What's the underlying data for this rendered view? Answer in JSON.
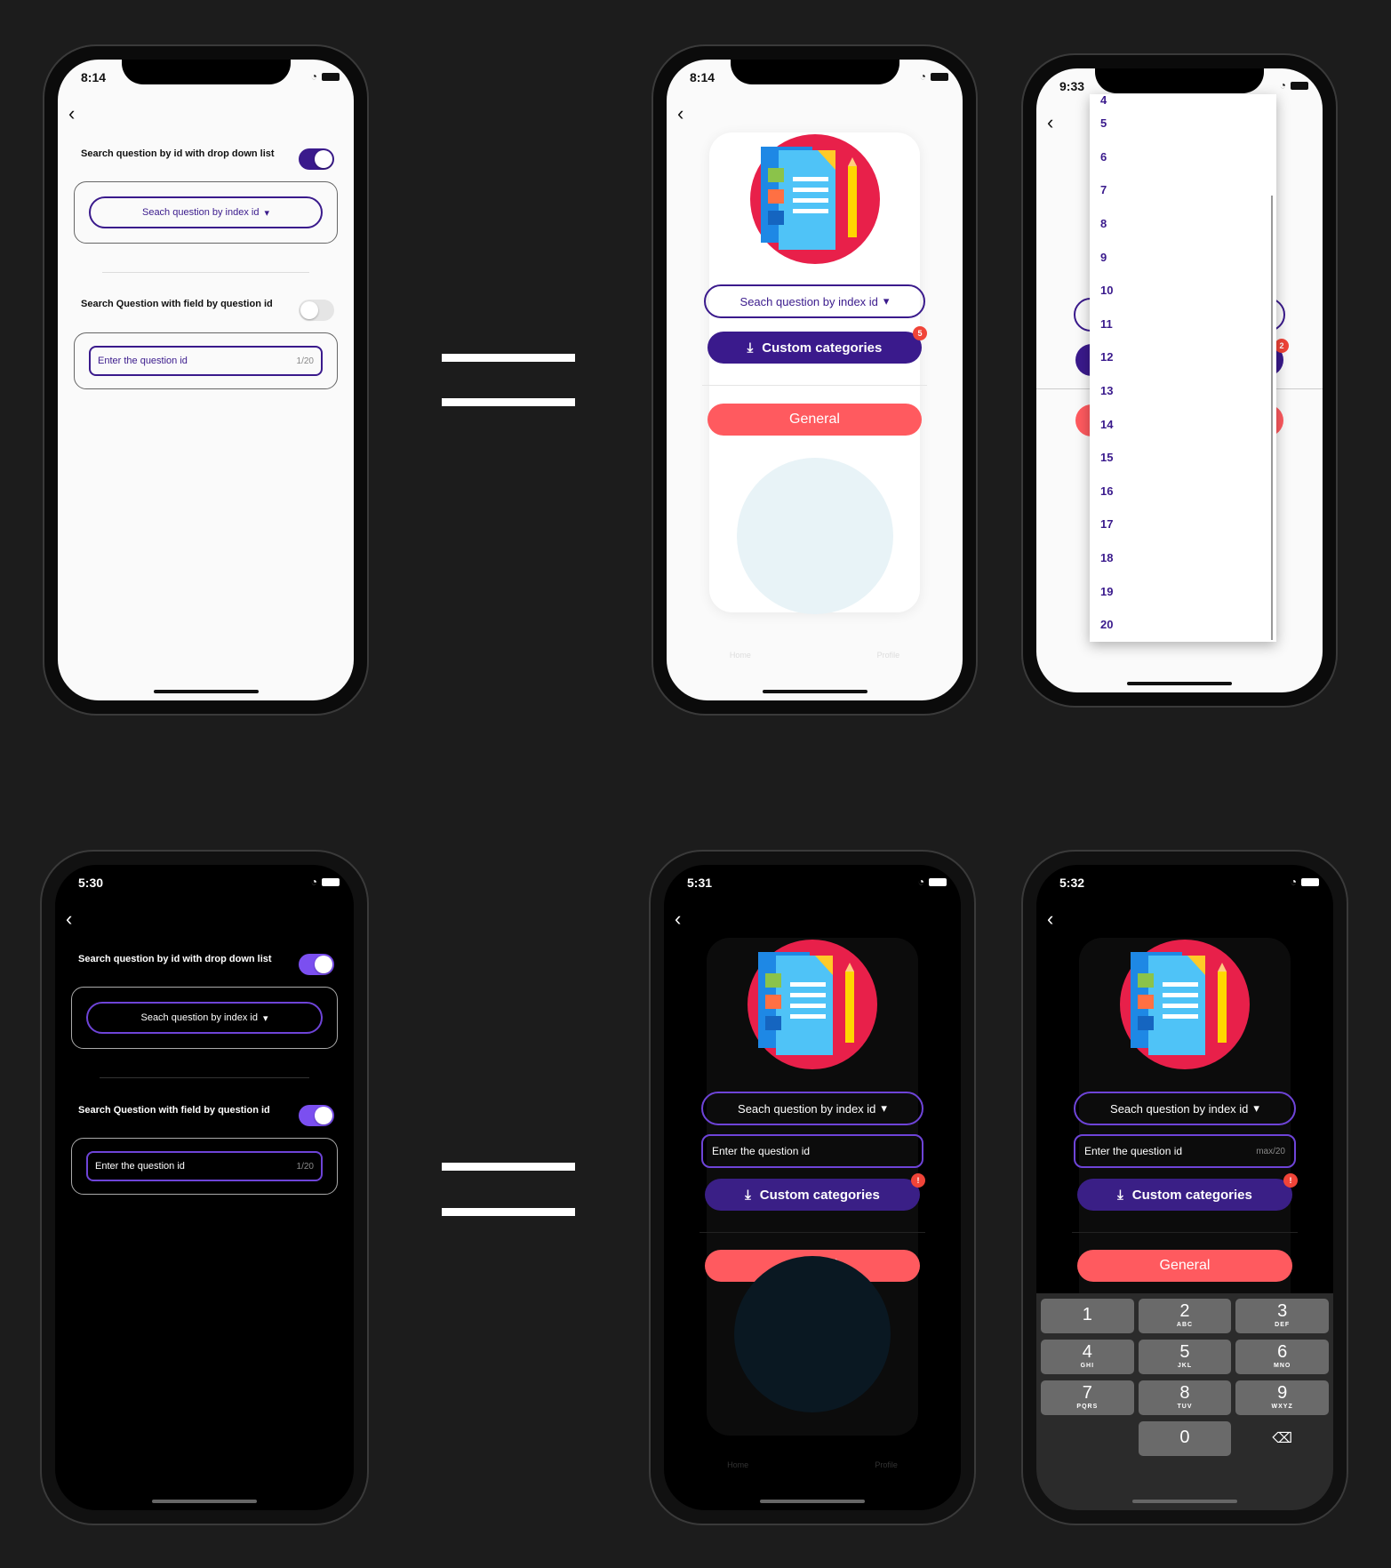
{
  "screens": {
    "settings_light": {
      "time": "8:14",
      "dropdown_label": "Search question by id with drop down list",
      "dropdown_pill": "Seach question by index id",
      "field_label": "Search Question with field by question id",
      "field_placeholder": "Enter the question id",
      "field_counter": "1/20"
    },
    "category_light": {
      "time": "8:14",
      "dropdown_pill": "Seach question by index id",
      "custom_button": "Custom categories",
      "badge": "5",
      "general_button": "General",
      "tab_home": "Home",
      "tab_profile": "Profile"
    },
    "dropdown_open": {
      "time": "9:33",
      "options": [
        "4",
        "5",
        "6",
        "7",
        "8",
        "9",
        "10",
        "11",
        "12",
        "13",
        "14",
        "15",
        "16",
        "17",
        "18",
        "19",
        "20"
      ],
      "badge": "2"
    },
    "settings_dark": {
      "time": "5:30",
      "dropdown_label": "Search question by id with drop down list",
      "dropdown_pill": "Seach question by index id",
      "field_label": "Search Question with field by question id",
      "field_placeholder": "Enter the question id",
      "field_counter": "1/20"
    },
    "category_dark": {
      "time": "5:31",
      "dropdown_pill": "Seach question by index id",
      "field_placeholder": "Enter the question id",
      "custom_button": "Custom categories",
      "badge": "!",
      "general_button": "General",
      "tab_home": "Home",
      "tab_profile": "Profile"
    },
    "keypad_dark": {
      "time": "5:32",
      "dropdown_pill": "Seach question by index id",
      "field_placeholder": "Enter the question id",
      "field_counter": "max/20",
      "custom_button": "Custom categories",
      "badge": "!",
      "general_button": "General",
      "keys": [
        {
          "d": "1",
          "l": ""
        },
        {
          "d": "2",
          "l": "ABC"
        },
        {
          "d": "3",
          "l": "DEF"
        },
        {
          "d": "4",
          "l": "GHI"
        },
        {
          "d": "5",
          "l": "JKL"
        },
        {
          "d": "6",
          "l": "MNO"
        },
        {
          "d": "7",
          "l": "PQRS"
        },
        {
          "d": "8",
          "l": "TUV"
        },
        {
          "d": "9",
          "l": "WXYZ"
        },
        {
          "d": "0",
          "l": ""
        }
      ]
    }
  },
  "colors": {
    "primary": "#3a1a8c",
    "primary_dark": "#7b4ff0",
    "accent": "#ff5a5f",
    "badge": "#f04438"
  },
  "icons": [
    "back-chevron-icon",
    "wifi-icon",
    "battery-icon",
    "download-icon",
    "caret-down-icon",
    "backspace-icon",
    "home-tab-icon",
    "profile-tab-icon"
  ]
}
